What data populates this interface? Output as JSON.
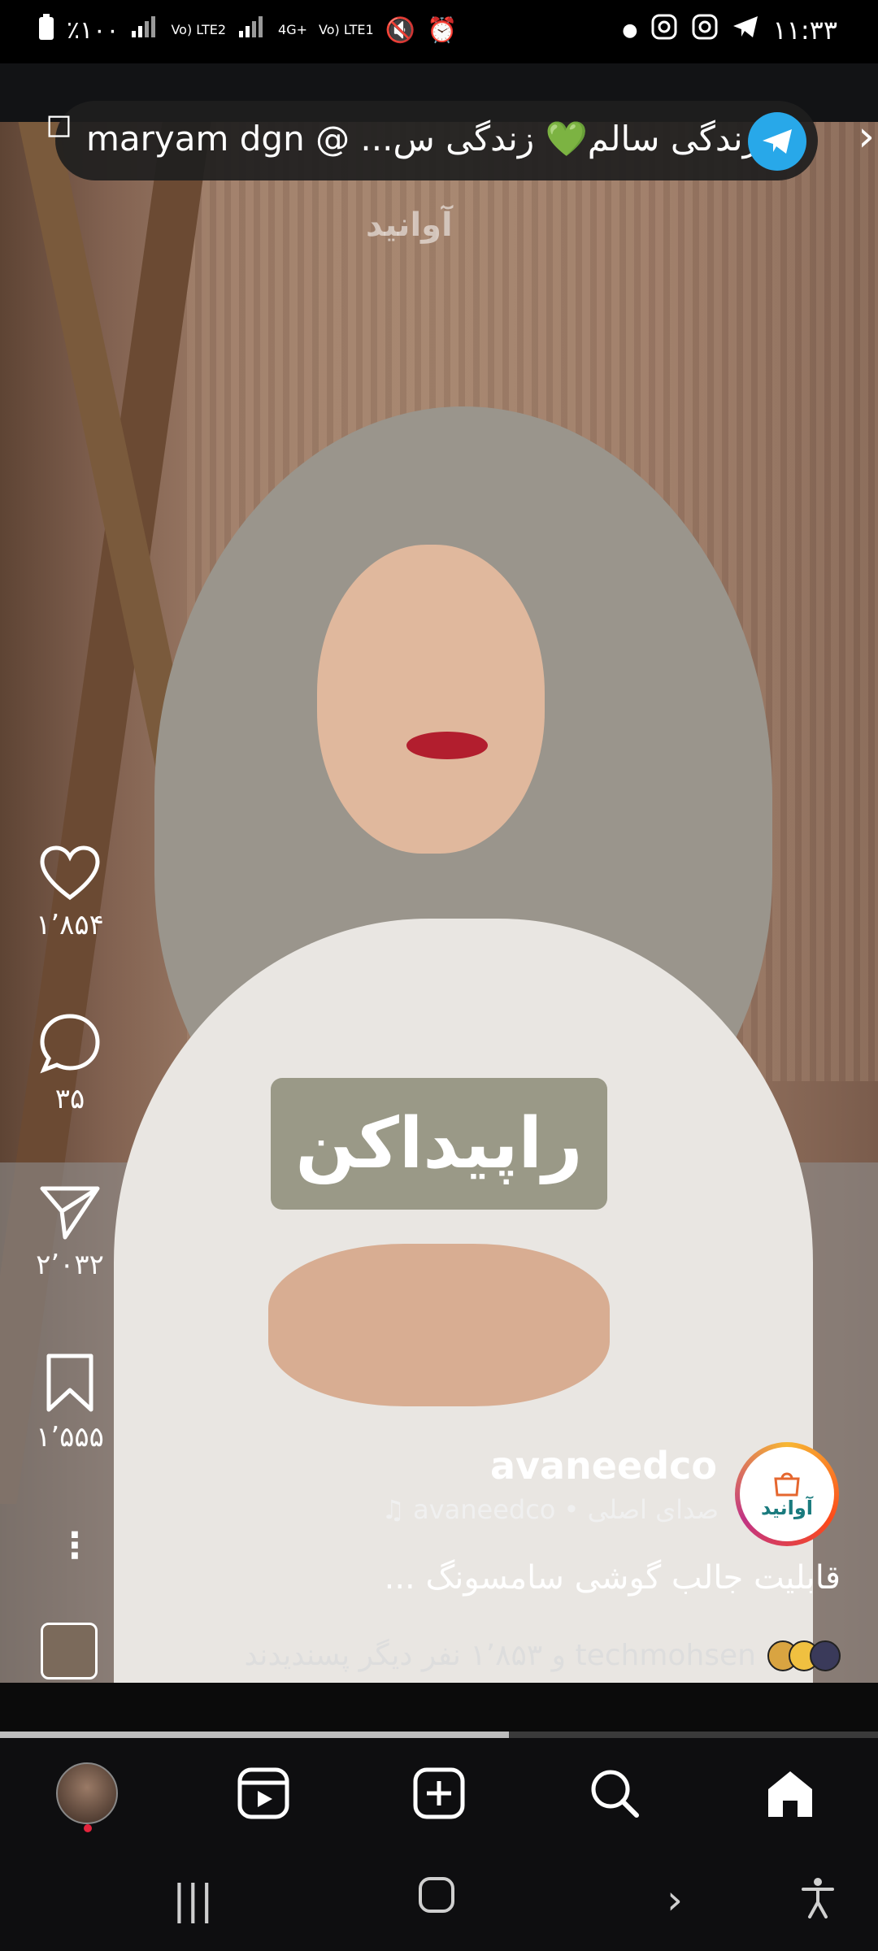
{
  "status_bar": {
    "battery_text": "٪۱۰۰",
    "network_labels": [
      "Vo) LTE2",
      "4G+",
      "Vo) LTE1"
    ],
    "time": "۱۱:۳۳"
  },
  "promo_banner": {
    "text": "maryam dgn @ ...زندگی سالم💚 زندگی س",
    "icon": "telegram-icon"
  },
  "video": {
    "watermark": "آوانید",
    "caption_overlay": "راپیداکن"
  },
  "actions": {
    "likes": "۱٬۸۵۴",
    "comments": "۳۵",
    "shares": "۲٬۰۳۲",
    "saves": "۱٬۵۵۵"
  },
  "author": {
    "avatar_label": "آوانید",
    "username": "avaneedco",
    "audio_text": "avaneedco • صدای اصلی",
    "description": "قابلیت جالب گوشی سامسونگ ...",
    "liked_by_text": "techmohsen و ۱٬۸۵۳ نفر دیگر پسندیدند"
  },
  "progress": 0.58,
  "bottom_nav": [
    "profile",
    "reels",
    "create",
    "search",
    "home"
  ],
  "colors": {
    "telegram": "#28a8e9",
    "notification_dot": "#e4253d",
    "progress_fill": "#bdbdbd"
  }
}
